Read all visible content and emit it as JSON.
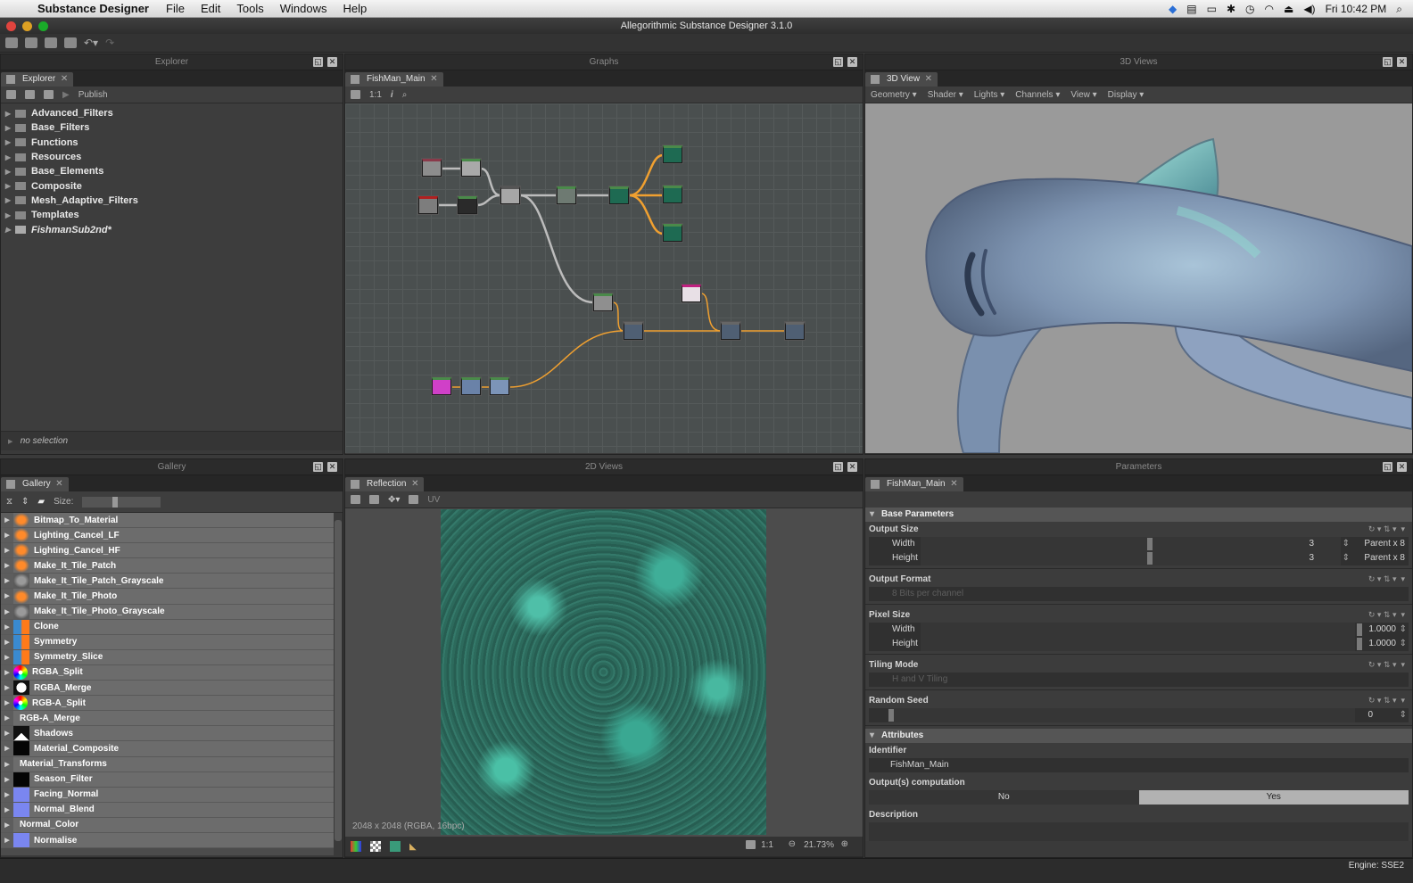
{
  "menubar": {
    "app_name": "Substance Designer",
    "items": [
      "File",
      "Edit",
      "Tools",
      "Windows",
      "Help"
    ],
    "clock": "Fri 10:42 PM"
  },
  "window": {
    "title": "Allegorithmic Substance Designer 3.1.0"
  },
  "explorer": {
    "dock_title": "Explorer",
    "tab": "Explorer",
    "publish_label": "Publish",
    "tree": [
      "Advanced_Filters",
      "Base_Filters",
      "Functions",
      "Resources",
      "Base_Elements",
      "Composite",
      "Mesh_Adaptive_Filters",
      "Templates",
      "FishmanSub2nd*"
    ],
    "selection_status": "no selection"
  },
  "graphs": {
    "dock_title": "Graphs",
    "tab": "FishMan_Main",
    "zoom_label": "1:1",
    "info_label": "i"
  },
  "views3d": {
    "dock_title": "3D Views",
    "tab": "3D View",
    "menus": [
      "Geometry",
      "Shader",
      "Lights",
      "Channels",
      "View",
      "Display"
    ]
  },
  "gallery": {
    "dock_title": "Gallery",
    "tab": "Gallery",
    "size_label": "Size:",
    "items": [
      {
        "label": "Bitmap_To_Material",
        "icon": "orange-splat-icon"
      },
      {
        "label": "Lighting_Cancel_LF",
        "icon": "orange-splat-icon"
      },
      {
        "label": "Lighting_Cancel_HF",
        "icon": "orange-splat-icon"
      },
      {
        "label": "Make_It_Tile_Patch",
        "icon": "orange-splat-icon"
      },
      {
        "label": "Make_It_Tile_Patch_Grayscale",
        "icon": "gray-splat-icon"
      },
      {
        "label": "Make_It_Tile_Photo",
        "icon": "orange-splat-icon"
      },
      {
        "label": "Make_It_Tile_Photo_Grayscale",
        "icon": "gray-splat-icon"
      },
      {
        "label": "Clone",
        "icon": "butterfly-icon"
      },
      {
        "label": "Symmetry",
        "icon": "butterfly-icon"
      },
      {
        "label": "Symmetry_Slice",
        "icon": "butterfly-icon"
      },
      {
        "label": "RGBA_Split",
        "icon": "color-wheel-icon"
      },
      {
        "label": "RGBA_Merge",
        "icon": "white-dot-icon"
      },
      {
        "label": "RGB-A_Split",
        "icon": "color-wheel-icon"
      },
      {
        "label": "RGB-A_Merge",
        "icon": "none"
      },
      {
        "label": "Shadows",
        "icon": "mountain-icon"
      },
      {
        "label": "Material_Composite",
        "icon": "black-icon"
      },
      {
        "label": "Material_Transforms",
        "icon": "none"
      },
      {
        "label": "Season_Filter",
        "icon": "black-icon"
      },
      {
        "label": "Facing_Normal",
        "icon": "blue-normal-icon"
      },
      {
        "label": "Normal_Blend",
        "icon": "blue-normal-icon"
      },
      {
        "label": "Normal_Color",
        "icon": "none"
      },
      {
        "label": "Normalise",
        "icon": "blue-normal-icon"
      }
    ]
  },
  "views2d": {
    "dock_title": "2D Views",
    "tab": "Reflection",
    "uv_label": "UV",
    "image_info": "2048 x 2048 (RGBA, 16bpc)",
    "ratio_label": "1:1",
    "zoom": "21.73%"
  },
  "parameters": {
    "dock_title": "Parameters",
    "tab": "FishMan_Main",
    "base_section": "Base Parameters",
    "output_size": {
      "label": "Output Size",
      "width_label": "Width",
      "width_value": "3",
      "width_mode": "Parent x 8",
      "width_fraction": 0.54,
      "height_label": "Height",
      "height_value": "3",
      "height_mode": "Parent x 8",
      "height_fraction": 0.54
    },
    "output_format": {
      "label": "Output Format",
      "value": "8 Bits per channel"
    },
    "pixel_size": {
      "label": "Pixel Size",
      "width_label": "Width",
      "width_value": "1.0000",
      "height_label": "Height",
      "height_value": "1.0000"
    },
    "tiling_mode": {
      "label": "Tiling Mode",
      "value": "H and V Tiling"
    },
    "random_seed": {
      "label": "Random Seed",
      "value": "0"
    },
    "attributes_section": "Attributes",
    "identifier": {
      "label": "Identifier",
      "value": "FishMan_Main"
    },
    "outputs_computation": {
      "label": "Output(s) computation",
      "no": "No",
      "yes": "Yes",
      "selected": "Yes"
    },
    "description": {
      "label": "Description"
    }
  },
  "status": {
    "engine": "Engine: SSE2"
  },
  "colors": {
    "graph_bg": "#4a4f4f",
    "wire_gray": "#bcbcbc",
    "wire_orange": "#f0a030",
    "teal_texture": "#2f6a5e",
    "viewport_bg": "#9a9a9a"
  }
}
